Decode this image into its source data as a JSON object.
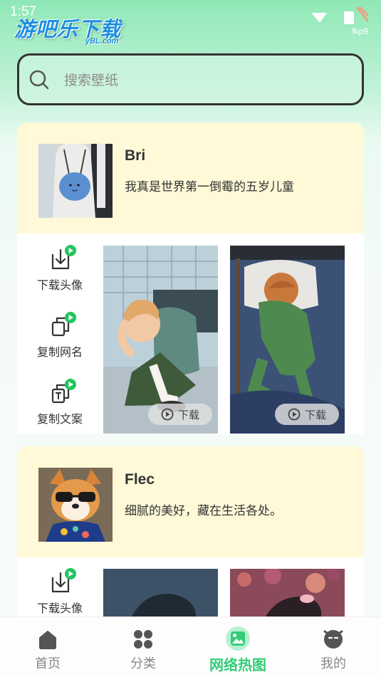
{
  "status_bar": {
    "time": "1:57",
    "extra": "fkp9"
  },
  "watermark": {
    "logo": "游吧乐下载",
    "logo_sub": "yBL.com"
  },
  "search": {
    "placeholder": "搜索壁纸"
  },
  "cards": [
    {
      "name": "Bri",
      "description": "我真是世界第一倒霉的五岁儿童",
      "actions": [
        "下载头像",
        "复制网名",
        "复制文案"
      ],
      "download_labels": [
        "下载",
        "下载"
      ]
    },
    {
      "name": "Flec",
      "description": "细腻的美好，藏在生活各处。",
      "actions": [
        "下载头像"
      ]
    }
  ],
  "tabs": [
    {
      "label": "首页",
      "icon": "home-icon"
    },
    {
      "label": "分类",
      "icon": "category-icon"
    },
    {
      "label": "网络热图",
      "icon": "image-icon",
      "active": true
    },
    {
      "label": "我的",
      "icon": "profile-icon"
    }
  ],
  "colors": {
    "accent": "#33cc77",
    "badge": "#22c55e",
    "card_header": "#fff9d8"
  }
}
